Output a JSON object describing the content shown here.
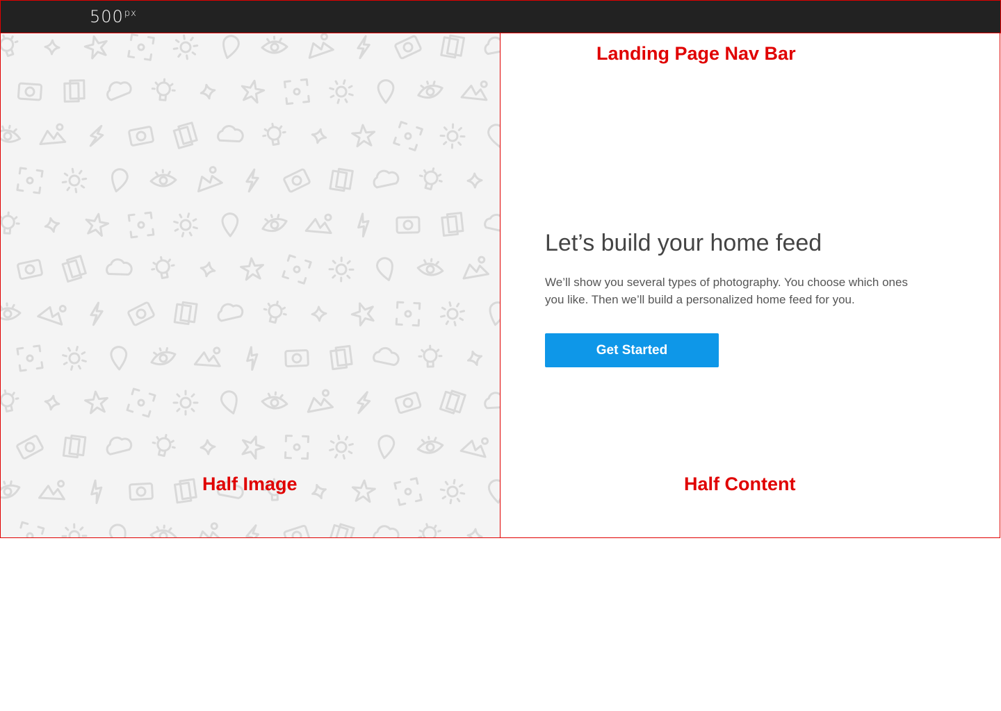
{
  "navbar": {
    "logo_main": "500",
    "logo_sup": "px",
    "annotation": "Landing Page Nav Bar"
  },
  "half_image": {
    "annotation": "Half Image",
    "pattern_icons": [
      "lightbulb-icon",
      "mountain-icon",
      "star-icon",
      "camera-icon",
      "sun-icon",
      "cloud-icon",
      "eye-icon",
      "sparkle-icon",
      "lightning-icon",
      "focus-icon",
      "photo-stack-icon",
      "pin-icon"
    ]
  },
  "half_content": {
    "annotation": "Half Content",
    "headline": "Let’s build your home feed",
    "description": "We’ll show you several types of photography. You choose which ones you like. Then we’ll build a personalized home feed for you.",
    "button_label": "Get Started"
  },
  "colors": {
    "navbar_bg": "#222222",
    "annotation_red": "#e00000",
    "button_blue": "#0e97e8",
    "pattern_stroke": "#d9d9d9"
  }
}
